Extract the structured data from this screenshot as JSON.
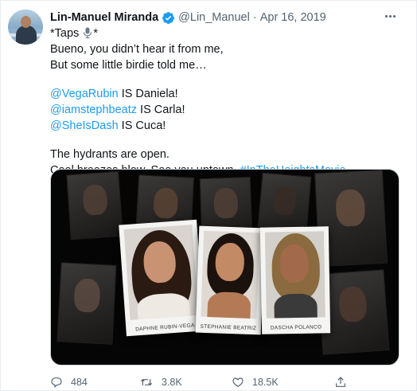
{
  "tweet": {
    "author": {
      "name": "Lin-Manuel Miranda",
      "handle": "@Lin_Manuel",
      "verified": true,
      "avatar_icon": "avatar-photo"
    },
    "separator": "·",
    "date": "Apr 16, 2019",
    "more_icon": "more-horizontal-icon",
    "text": {
      "taps_prefix": "*Taps ",
      "taps_suffix": "*",
      "line2": "Bueno, you didn’t hear it from me,",
      "line3": "But some little birdie told me…",
      "mention1": "@VegaRubin",
      "mention1_suffix": " IS Daniela!",
      "mention2": "@iamstephbeatz",
      "mention2_suffix": " IS Carla!",
      "mention3": "@SheIsDash",
      "mention3_suffix": " IS Cuca!",
      "line7": "The hydrants are open.",
      "line8_prefix": "Cool breezes blow. See you uptown. ",
      "hashtag": "#InTheHeightsMovie"
    },
    "media": {
      "captions": [
        "DAPHNE RUBIN-VEGA",
        "STEPHANIE BEATRIZ",
        "DASCHA POLANCO"
      ]
    },
    "actions": {
      "reply_count": "484",
      "retweet_count": "3.8K",
      "like_count": "18.5K"
    },
    "colors": {
      "link": "#1d9bf0",
      "secondary": "#536471",
      "verified": "#1d9bf0"
    }
  }
}
